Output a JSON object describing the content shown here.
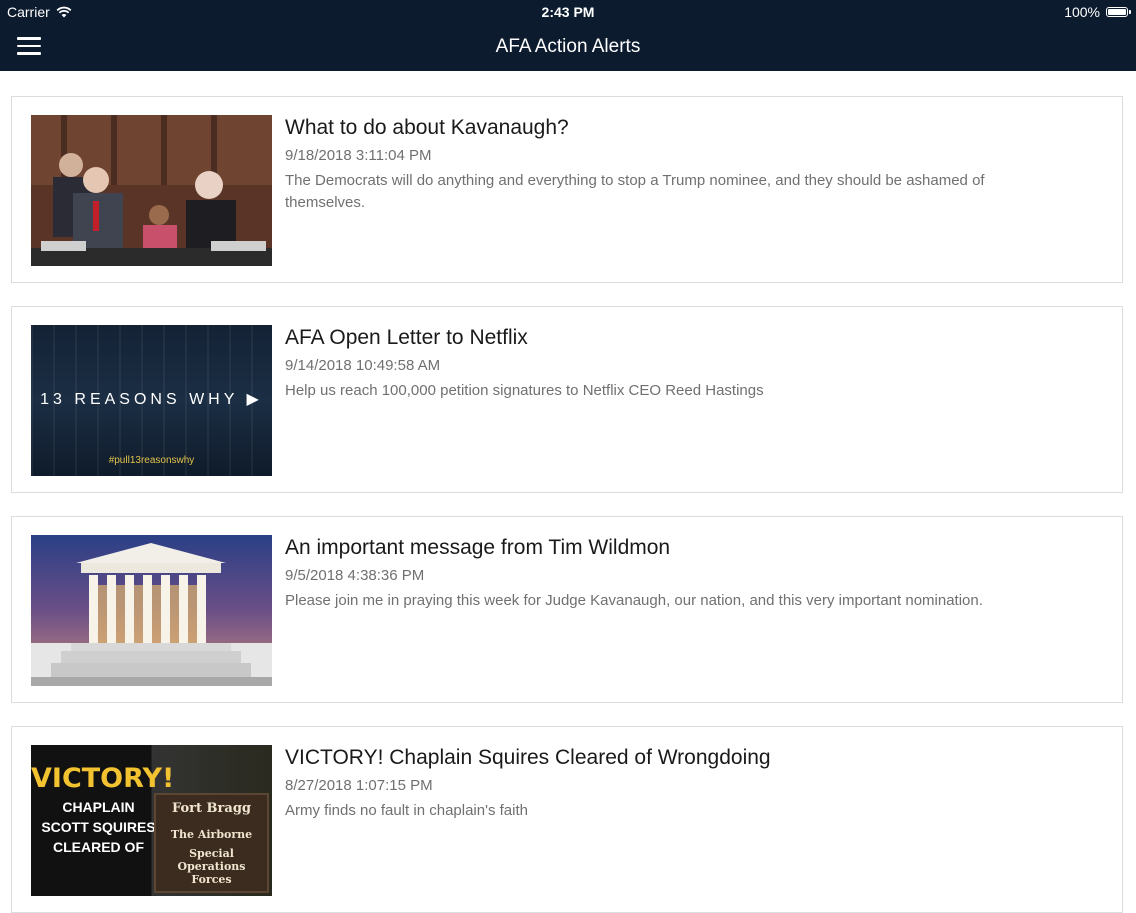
{
  "status_bar": {
    "carrier": "Carrier",
    "time": "2:43 PM",
    "battery": "100%"
  },
  "header": {
    "title": "AFA Action Alerts",
    "menu_icon": "hamburger-menu-icon"
  },
  "alerts": [
    {
      "title": "What to do about Kavanaugh?",
      "date": "9/18/2018 3:11:04 PM",
      "description": "The Democrats will do anything and everything to stop a Trump nominee, and they should be ashamed of themselves."
    },
    {
      "title": "AFA Open Letter to Netflix",
      "date": "9/14/2018 10:49:58 AM",
      "description": "Help us reach 100,000 petition signatures to Netflix CEO Reed Hastings",
      "thumb_caption": "13 REASONS WHY ▶",
      "thumb_tag": "#pull13reasonswhy"
    },
    {
      "title": "An important message from Tim Wildmon",
      "date": "9/5/2018 4:38:36 PM",
      "description": "Please join me in praying this week for Judge Kavanaugh, our nation, and this very important nomination."
    },
    {
      "title": "VICTORY! Chaplain Squires Cleared of Wrongdoing",
      "date": "8/27/2018 1:07:15 PM",
      "description": "Army finds no fault in chaplain's faith",
      "thumb_headline": "VICTORY!",
      "thumb_sub_1": "CHAPLAIN",
      "thumb_sub_2": "SCOTT SQUIRES",
      "thumb_sub_3": "CLEARED OF",
      "thumb_sign_1": "Fort Bragg",
      "thumb_sign_2": "The Airborne",
      "thumb_sign_3": "Special Operations Forces"
    }
  ]
}
